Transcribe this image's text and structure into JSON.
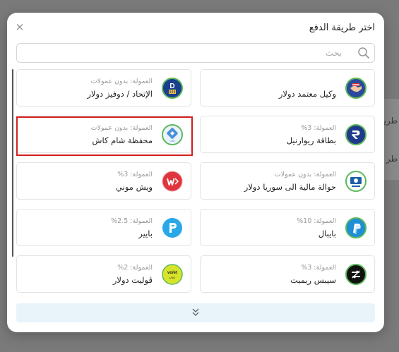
{
  "background": {
    "partial_text_1": "طريقة",
    "partial_text_2": "طر"
  },
  "modal": {
    "title": "اختر طريقة الدفع",
    "close_label": "×"
  },
  "search": {
    "placeholder": "بحث",
    "value": ""
  },
  "methods": [
    {
      "name": "وكيل معتمد دولار",
      "fee": "",
      "icon": "handshake-icon",
      "color": "#2b4a9c"
    },
    {
      "name": "الإتحاد / دوفيز دولار",
      "fee": "العمولة: بدون عمولات",
      "icon": "dovizz-icon",
      "color": "#1a3f8f"
    },
    {
      "name": "بطاقة ريوارنيل",
      "fee": "العمولة: 3%",
      "icon": "r-card-icon",
      "color": "#1f3a8a"
    },
    {
      "name": "محفظة شام كاش",
      "fee": "العمولة: بدون عمولات",
      "icon": "sham-cash-icon",
      "color": "#4a90d9"
    },
    {
      "name": "حوالة مالية الى سوريا دولار",
      "fee": "العمولة: بدون عمولات",
      "icon": "transfer-syria-icon",
      "color": "#1f5fa8"
    },
    {
      "name": "ويش موني",
      "fee": "العمولة: 3%",
      "icon": "wish-money-icon",
      "color": "#e0343e"
    },
    {
      "name": "بايبال",
      "fee": "العمولة: 10%",
      "icon": "paypal-icon",
      "color": "#1e8fd6"
    },
    {
      "name": "بايير",
      "fee": "العمولة: 2.5%",
      "icon": "payeer-icon",
      "color": "#29a8e8"
    },
    {
      "name": "سيبس ريميت",
      "fee": "العمولة: 3%",
      "icon": "sepa-remit-icon",
      "color": "#111111"
    },
    {
      "name": "ڤوليت دولار",
      "fee": "العمولة: 2%",
      "icon": "volet-icon",
      "color": "#d8e42a"
    }
  ],
  "load_more_icon": "double-chevron-down-icon",
  "colors": {
    "overlay": "#6f6f6f",
    "highlight": "#d42020",
    "load_more_bg": "#e9f4fa",
    "logo_ring": "#5cb85c"
  }
}
